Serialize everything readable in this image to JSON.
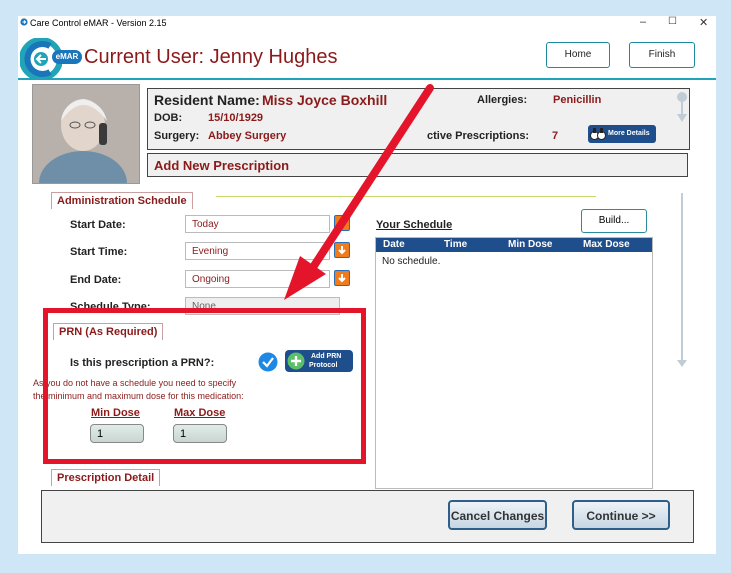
{
  "window": {
    "title": "Care Control eMAR - Version 2.15",
    "min_glyph": "–",
    "max_glyph": "☐",
    "close_glyph": "✕"
  },
  "header": {
    "badge": "eMAR",
    "current_user": "Current User: Jenny Hughes",
    "home_label": "Home",
    "finish_label": "Finish"
  },
  "resident": {
    "name_label": "Resident Name:",
    "name": "Miss Joyce Boxhill",
    "dob_label": "DOB:",
    "dob": "15/10/1929",
    "surgery_label": "Surgery:",
    "surgery": "Abbey Surgery",
    "allergies_label": "Allergies:",
    "allergies": "Penicillin",
    "active_label": "ctive Prescriptions:",
    "active_count": "7",
    "more_details": "More Details"
  },
  "add_new": "Add New Prescription",
  "schedule": {
    "section_title": "Administration Schedule",
    "start_date_label": "Start Date:",
    "start_date": "Today",
    "start_time_label": "Start Time:",
    "start_time": "Evening",
    "end_date_label": "End Date:",
    "end_date": "Ongoing",
    "schedule_type_label": "Schedule Type:",
    "schedule_type": "None"
  },
  "your_schedule": {
    "title": "Your Schedule",
    "build_label": "Build...",
    "columns": [
      "Date",
      "Time",
      "Min Dose",
      "Max Dose"
    ],
    "empty_text": "No schedule."
  },
  "prn": {
    "section_title": "PRN (As Required)",
    "question": "Is this prescription a PRN?:",
    "add_protocol": [
      "Add PRN",
      "Protocol"
    ],
    "note_line1": "As you do not have a schedule you need to specify",
    "note_line2": "the minimum and maximum dose for this medication:",
    "min_label": "Min Dose",
    "min_value": "1",
    "max_label": "Max Dose",
    "max_value": "1"
  },
  "prescription_detail": "Prescription Detail",
  "footer": {
    "cancel_label": "Cancel Changes",
    "continue_label": "Continue >>"
  },
  "colors": {
    "accent_teal": "#21a4b7",
    "resident_red": "#8b1a1a",
    "highlight_red": "#e4142b",
    "table_header": "#1f4e8c",
    "orange_button": "#f07b1d"
  }
}
